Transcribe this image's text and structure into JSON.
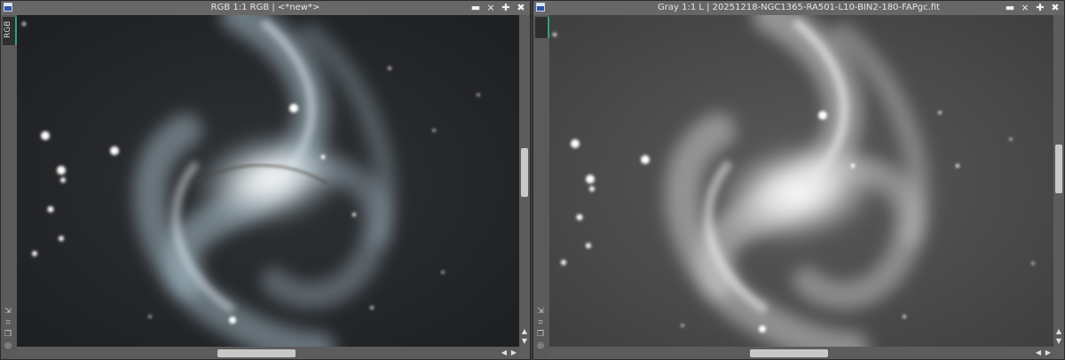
{
  "left_window": {
    "title": "RGB 1:1 RGB | <*new*>",
    "sidebar_tab": "RGB",
    "accent": "#2ea36b"
  },
  "right_window": {
    "title": "Gray 1:1 L | 20251218-NGC1365-RA501-L10-BIN2-180-FAPgc.fit",
    "accent": "#2ea36b"
  },
  "controls": {
    "minimize": "▬",
    "shade": "⨯",
    "maximize": "✚",
    "close": "✖"
  },
  "icons": [
    "window-icon",
    "minimize-icon",
    "shade-icon",
    "maximize-icon",
    "close-icon",
    "scroll-up-icon",
    "scroll-down-icon",
    "scroll-left-icon",
    "scroll-right-icon"
  ]
}
